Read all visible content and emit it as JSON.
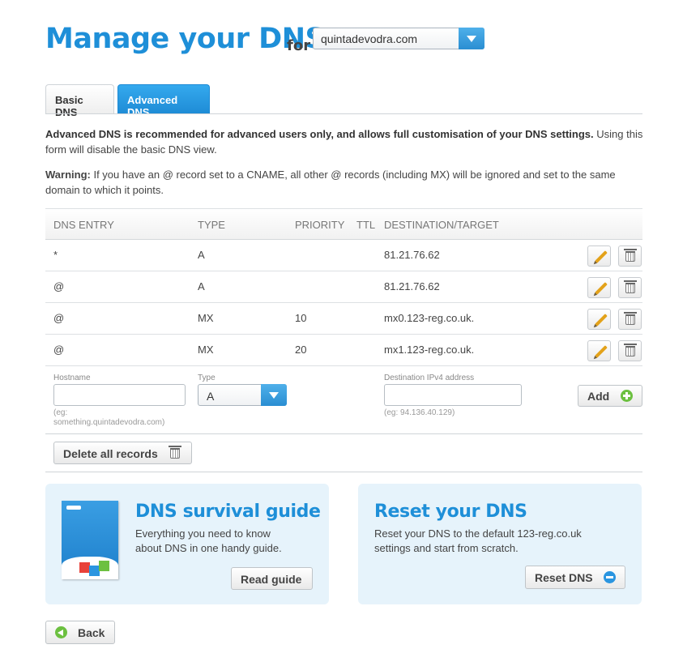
{
  "header": {
    "title": "Manage your DNS",
    "for_label": "for",
    "domain": "quintadevodra.com"
  },
  "tabs": [
    {
      "label": "Basic DNS",
      "active": false
    },
    {
      "label": "Advanced DNS",
      "active": true
    }
  ],
  "intro": {
    "bold": "Advanced DNS is recommended for advanced users only, and allows full customisation of your DNS settings.",
    "rest": " Using this form will disable the basic DNS view."
  },
  "warning": {
    "bold": "Warning:",
    "rest": " If you have an @ record set to a CNAME, all other @ records (including MX) will be ignored and set to the same domain to which it points."
  },
  "table": {
    "headers": [
      "DNS ENTRY",
      "TYPE",
      "PRIORITY",
      "TTL",
      "DESTINATION/TARGET"
    ],
    "rows": [
      {
        "entry": "*",
        "type": "A",
        "priority": "",
        "ttl": "",
        "target": "81.21.76.62"
      },
      {
        "entry": "@",
        "type": "A",
        "priority": "",
        "ttl": "",
        "target": "81.21.76.62"
      },
      {
        "entry": "@",
        "type": "MX",
        "priority": "10",
        "ttl": "",
        "target": "mx0.123-reg.co.uk."
      },
      {
        "entry": "@",
        "type": "MX",
        "priority": "20",
        "ttl": "",
        "target": "mx1.123-reg.co.uk."
      }
    ]
  },
  "add_form": {
    "hostname_label": "Hostname",
    "hostname_value": "",
    "hostname_hint_1": "(eg:",
    "hostname_hint_2": "something.quintadevodra.com)",
    "type_label": "Type",
    "type_value": "A",
    "dest_label": "Destination IPv4 address",
    "dest_value": "",
    "dest_hint": "(eg: 94.136.40.129)",
    "add_label": "Add"
  },
  "delete_all_label": "Delete all records",
  "guide": {
    "title": "DNS survival guide",
    "text_1": "Everything you need to know",
    "text_2": "about DNS in one handy guide.",
    "button": "Read guide"
  },
  "reset": {
    "title": "Reset your DNS",
    "text_1": "Reset your DNS to the default 123-reg.co.uk",
    "text_2": "settings and start from scratch.",
    "button": "Reset DNS"
  },
  "back_label": "Back",
  "colors": {
    "brand_blue": "#1e8fd8",
    "add_green": "#6cc040",
    "panel_bg": "#e6f3fb"
  }
}
